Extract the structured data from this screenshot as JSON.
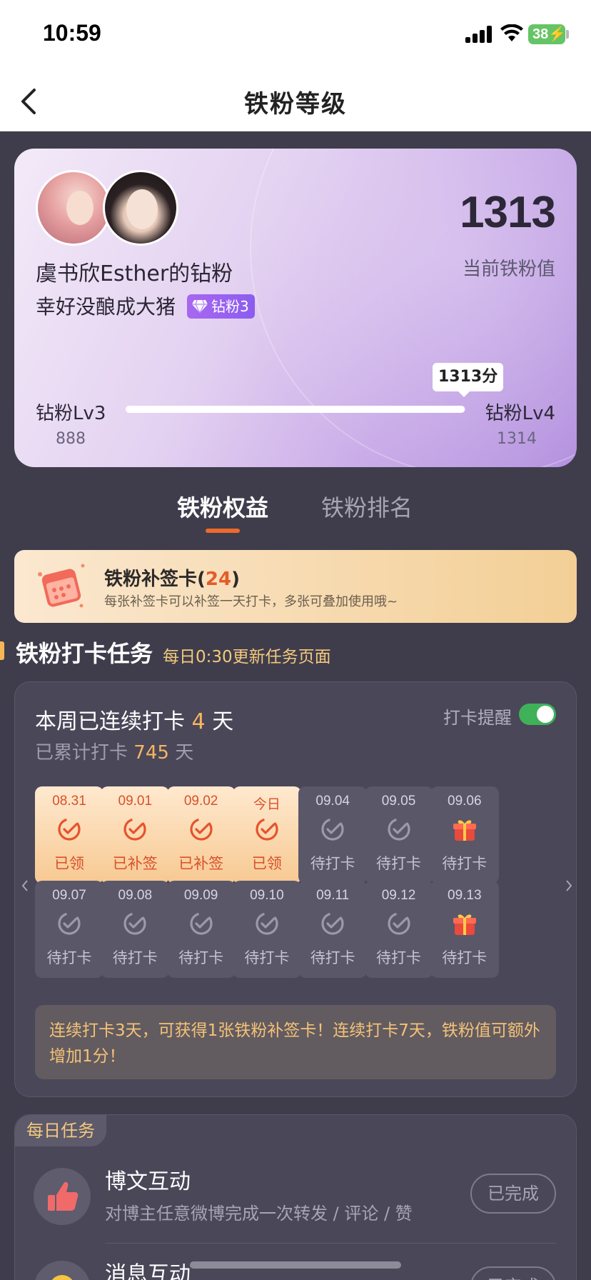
{
  "status_bar": {
    "time": "10:59",
    "battery": "38"
  },
  "nav": {
    "title": "铁粉等级"
  },
  "hero": {
    "fan_name": "虞书欣Esther的钻粉",
    "fan_subtitle": "幸好没酿成大猪",
    "badge": "钻粉3",
    "score": "1313",
    "score_label": "当前铁粉值",
    "level_current": "钻粉Lv3",
    "level_next": "钻粉Lv4",
    "min_value": "888",
    "max_value": "1314",
    "progress_tip": "1313分",
    "progress_fraction": 0.9977
  },
  "tabs": [
    {
      "label": "铁粉权益",
      "active": true
    },
    {
      "label": "铁粉排名",
      "active": false
    }
  ],
  "makeup_card": {
    "title": "铁粉补签卡",
    "count_open": "(",
    "count": "24",
    "count_close": ")",
    "description": "每张补签卡可以补签一天打卡，多张可叠加使用哦~"
  },
  "section": {
    "title": "铁粉打卡任务",
    "subtitle": "每日0:30更新任务页面"
  },
  "checkin": {
    "streak_prefix": "本周已连续打卡",
    "streak_days": "4",
    "streak_unit": "天",
    "total_prefix": "已累计打卡",
    "total_days": "745",
    "total_unit": "天",
    "remind_label": "打卡提醒",
    "remind_on": true,
    "days": [
      {
        "date": "08.31",
        "label": "已领",
        "state": "done",
        "icon": "check-icon"
      },
      {
        "date": "09.01",
        "label": "已补签",
        "state": "done",
        "icon": "check-icon"
      },
      {
        "date": "09.02",
        "label": "已补签",
        "state": "done",
        "icon": "check-icon"
      },
      {
        "date": "今日",
        "label": "已领",
        "state": "done",
        "icon": "check-icon"
      },
      {
        "date": "09.04",
        "label": "待打卡",
        "state": "pending",
        "icon": "check-icon"
      },
      {
        "date": "09.05",
        "label": "待打卡",
        "state": "pending",
        "icon": "check-icon"
      },
      {
        "date": "09.06",
        "label": "待打卡",
        "state": "pending",
        "icon": "gift-icon"
      },
      {
        "date": "09.07",
        "label": "待打卡",
        "state": "pending",
        "icon": "check-icon"
      },
      {
        "date": "09.08",
        "label": "待打卡",
        "state": "pending",
        "icon": "check-icon"
      },
      {
        "date": "09.09",
        "label": "待打卡",
        "state": "pending",
        "icon": "check-icon"
      },
      {
        "date": "09.10",
        "label": "待打卡",
        "state": "pending",
        "icon": "check-icon"
      },
      {
        "date": "09.11",
        "label": "待打卡",
        "state": "pending",
        "icon": "check-icon"
      },
      {
        "date": "09.12",
        "label": "待打卡",
        "state": "pending",
        "icon": "check-icon"
      },
      {
        "date": "09.13",
        "label": "待打卡",
        "state": "pending",
        "icon": "gift-icon"
      }
    ],
    "tip": "连续打卡3天，可获得1张铁粉补签卡！连续打卡7天，铁粉值可额外增加1分！"
  },
  "daily_tasks": {
    "badge": "每日任务",
    "items": [
      {
        "title": "博文互动",
        "description": "对博主任意微博完成一次转发 / 评论 / 赞",
        "button": "已完成",
        "icon": "thumbs-up-icon"
      },
      {
        "title": "消息互动",
        "description": "",
        "button": "已完成",
        "icon": "message-icon"
      }
    ]
  },
  "colors": {
    "accent": "#ee6a2b",
    "highlight": "#f5b65f",
    "toggle_on": "#3fb158",
    "background": "#3f3d4c"
  }
}
